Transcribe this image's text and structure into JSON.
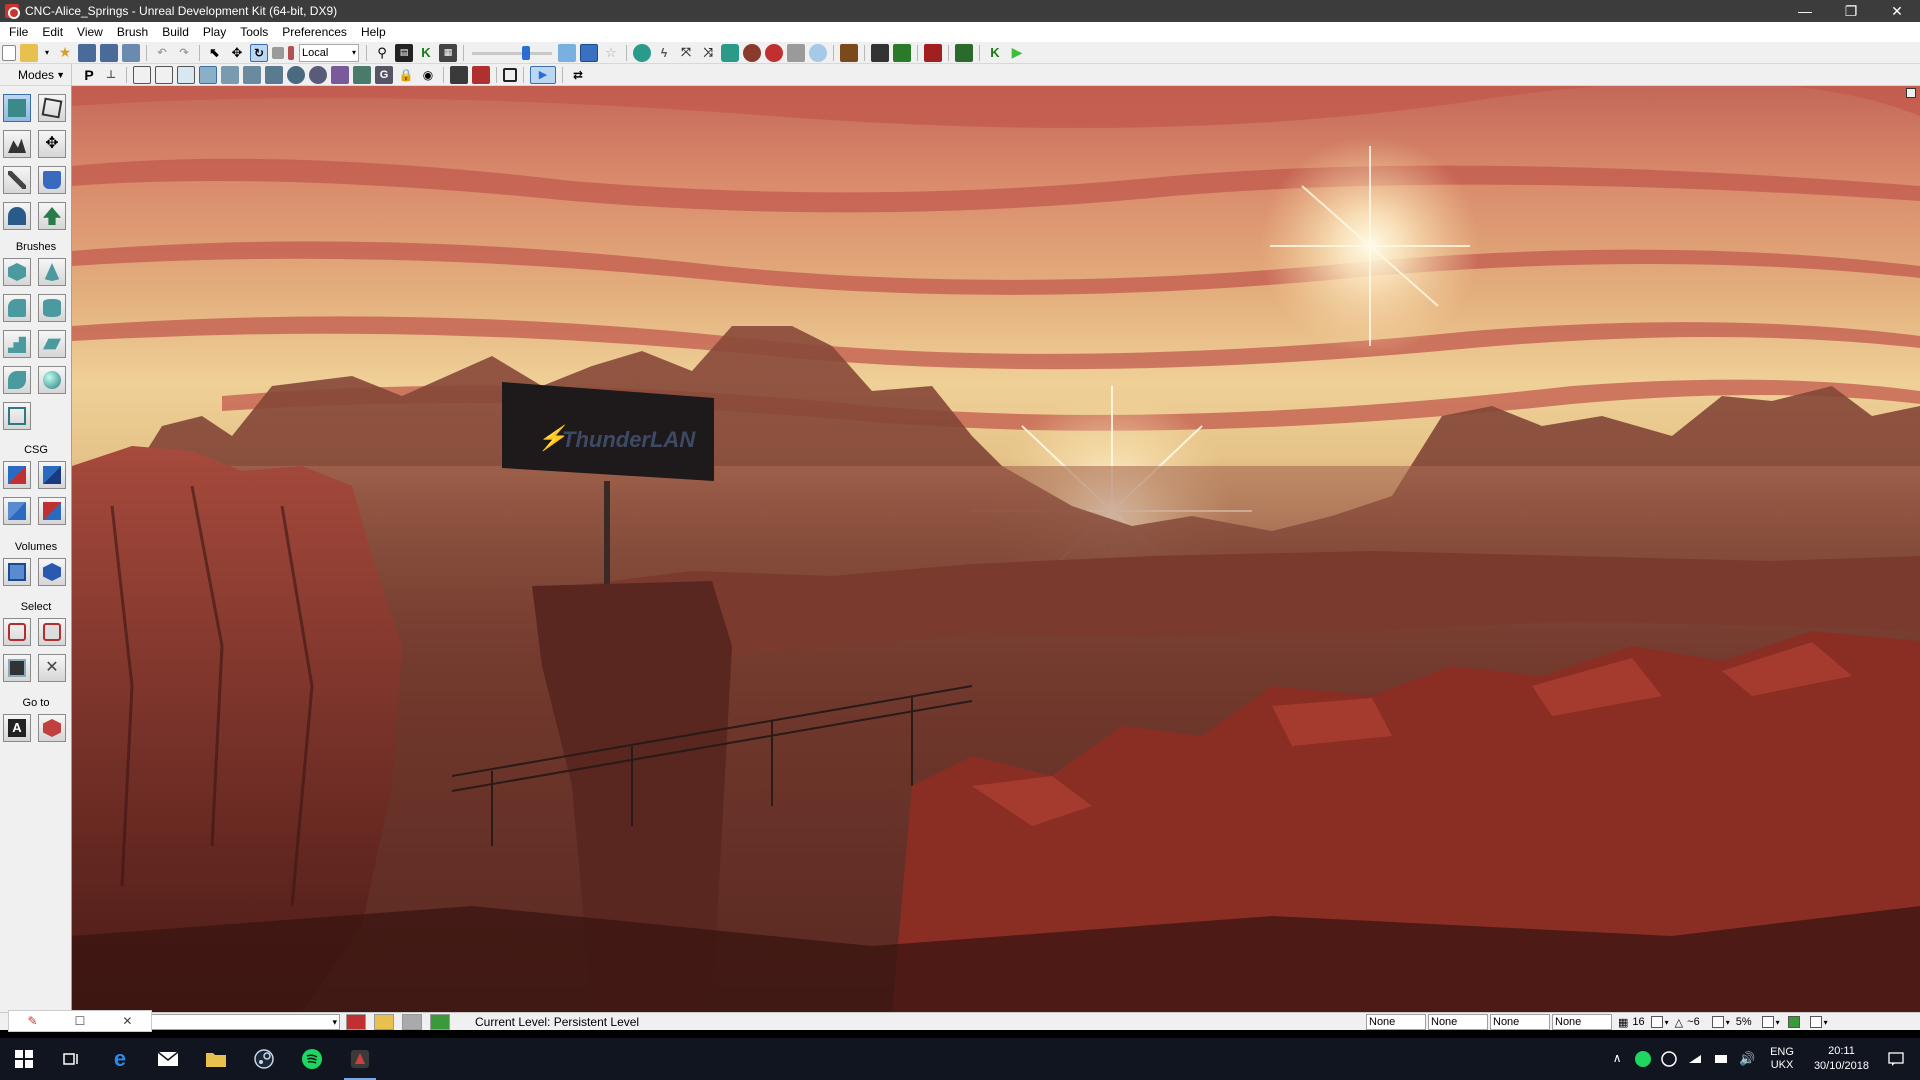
{
  "window": {
    "title": "CNC-Alice_Springs - Unreal Development Kit (64-bit, DX9)",
    "minimize": "—",
    "restore": "❐",
    "close": "✕"
  },
  "menu": {
    "items": [
      "File",
      "Edit",
      "View",
      "Brush",
      "Build",
      "Play",
      "Tools",
      "Preferences",
      "Help"
    ]
  },
  "toolbar": {
    "coordinate_system": "Local",
    "drag_grid_slider_value": 0.7
  },
  "modes": {
    "label": "Modes",
    "sections": {
      "brushes": "Brushes",
      "csg": "CSG",
      "volumes": "Volumes",
      "select": "Select",
      "goto": "Go to"
    },
    "goto_actor_label": "A"
  },
  "viewport": {
    "billboard_text": "ThunderLAN"
  },
  "status": {
    "current_level_label": "Current Level:",
    "current_level_value": "Persistent Level",
    "fields": [
      "None",
      "None",
      "None",
      "None"
    ],
    "grid_size": "16",
    "rotation_snap": "~6",
    "scale_snap": "5%"
  },
  "taskbar": {
    "language_line1": "ENG",
    "language_line2": "UKX",
    "time": "20:11",
    "date": "30/10/2018"
  },
  "colors": {
    "accent_blue": "#2a6ed4",
    "play_green": "#3cbf3c",
    "taskbar_bg": "#101520"
  }
}
